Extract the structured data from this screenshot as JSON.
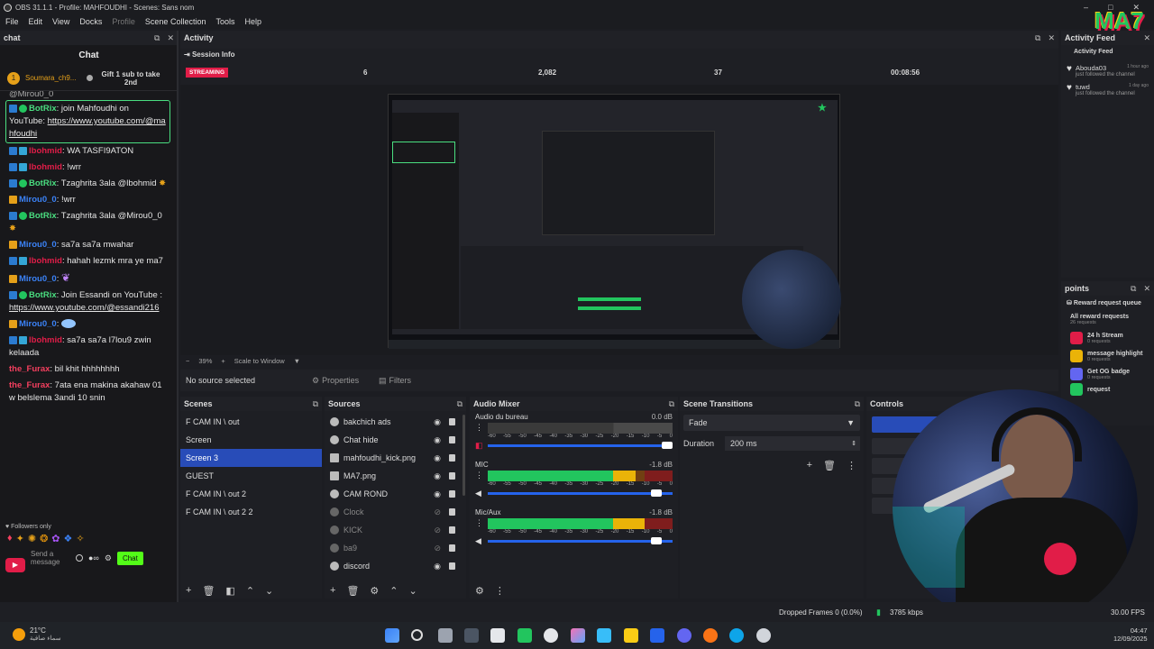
{
  "window": {
    "title": "OBS 31.1.1 - Profile: MAHFOUDHI - Scenes: Sans nom",
    "min": "–",
    "max": "□",
    "close": "✕"
  },
  "menu": [
    "File",
    "Edit",
    "View",
    "Docks",
    "Profile",
    "Scene Collection",
    "Tools",
    "Help"
  ],
  "chat": {
    "dock_title": "chat",
    "header": "Chat",
    "pinned_user": "Soumara_ch9...",
    "pinned_count": "1",
    "gift_text": "Gift 1 sub to take 2nd",
    "top_cut": "@Mirou0_0",
    "messages": [
      {
        "user": "BotRix",
        "text": ": join Mahfoudhi on YouTube: ",
        "link": "https://www.youtube.com/@mahfoudhi"
      },
      {
        "user": "lbohmid",
        "text": ": WA TASFI9ATON"
      },
      {
        "user": "lbohmid",
        "text": ": !wrr"
      },
      {
        "user": "BotRix",
        "text": ": Tzaghrita 3ala @lbohmid"
      },
      {
        "user": "Mirou0_0",
        "text": ": !wrr"
      },
      {
        "user": "BotRix",
        "text": ": Tzaghrita 3ala @Mirou0_0"
      },
      {
        "user": "Mirou0_0",
        "text": ": sa7a sa7a mwahar"
      },
      {
        "user": "lbohmid",
        "text": ": hahah lezmk mra ye ma7"
      },
      {
        "user": "Mirou0_0",
        "text": ": "
      },
      {
        "user": "BotRix",
        "text": ": Join Essandi on YouTube : ",
        "link": "https://www.youtube.com/@essandi216"
      },
      {
        "user": "Mirou0_0",
        "text": ": "
      },
      {
        "user": "lbohmid",
        "text": ": sa7a sa7a l7lou9 zwin kelaada"
      },
      {
        "user": "the_Furax",
        "text": ": bil khit hhhhhhhh"
      },
      {
        "user": "the_Furax",
        "text": ": 7ata ena makina akahaw 01 w belslema 3andi 10 snin"
      }
    ],
    "followers_only": "Followers only",
    "send_placeholder": "Send a message",
    "chat_button": "Chat"
  },
  "activity": {
    "dock_title": "Activity",
    "session_info": "Session Info",
    "status": "STREAMING",
    "stat1": "6",
    "stat2": "2,082",
    "stat3": "37",
    "time": "00:08:56"
  },
  "preview": {
    "zoom": "39%",
    "scale": "Scale to Window",
    "no_source": "No source selected",
    "properties": "Properties",
    "filters": "Filters"
  },
  "scenes": {
    "title": "Scenes",
    "items": [
      "F CAM IN \\ out",
      "Screen",
      "Screen 3",
      "GUEST",
      "F CAM IN \\ out 2",
      "F CAM IN \\ out 2 2"
    ],
    "selected": 2
  },
  "sources": {
    "title": "Sources",
    "items": [
      {
        "name": "bakchich ads",
        "dim": false
      },
      {
        "name": "Chat hide",
        "dim": false
      },
      {
        "name": "mahfoudhi_kick.png",
        "dim": false
      },
      {
        "name": "MA7.png",
        "dim": false
      },
      {
        "name": "CAM ROND",
        "dim": false
      },
      {
        "name": "Clock",
        "dim": true
      },
      {
        "name": "KICK",
        "dim": true
      },
      {
        "name": "ba9",
        "dim": true
      },
      {
        "name": "discord",
        "dim": false
      }
    ]
  },
  "mixer": {
    "title": "Audio Mixer",
    "channels": [
      {
        "name": "Audio du bureau",
        "db": "0.0 dB",
        "level": 0
      },
      {
        "name": "MIC",
        "db": "-1.8 dB",
        "level": 0.8
      },
      {
        "name": "Mic/Aux",
        "db": "-1.8 dB",
        "level": 0.85
      }
    ],
    "ticks": [
      "-60",
      "-55",
      "-50",
      "-45",
      "-40",
      "-35",
      "-30",
      "-25",
      "-20",
      "-15",
      "-10",
      "-5",
      "0"
    ]
  },
  "transitions": {
    "title": "Scene Transitions",
    "type": "Fade",
    "duration_label": "Duration",
    "duration": "200 ms"
  },
  "controls": {
    "title": "Controls"
  },
  "activity_feed": {
    "dock_title": "Activity Feed",
    "header": "Activity Feed",
    "items": [
      {
        "user": "Abouda03",
        "text": "just followed the channel",
        "time": "1 hour ago"
      },
      {
        "user": "tuwd",
        "text": "just followed the channel",
        "time": "1 day ago"
      }
    ]
  },
  "points": {
    "dock_title": "points",
    "queue": "Reward request queue",
    "all": "All reward requests",
    "all_count": "26 requests",
    "items": [
      {
        "name": "24 h Stream",
        "count": "0 requests",
        "color": "#e11d48"
      },
      {
        "name": "message highlight",
        "count": "0 requests",
        "color": "#eab308"
      },
      {
        "name": "Get OG badge",
        "count": "0 requests",
        "color": "#6366f1"
      },
      {
        "name": "request",
        "count": "",
        "color": "#22c55e"
      }
    ]
  },
  "statusbar": {
    "dropped": "Dropped Frames 0 (0.0%)",
    "bitrate": "3785 kbps",
    "fps": "30.00 FPS"
  },
  "taskbar": {
    "temp": "21°C",
    "weather": "سماء صافية",
    "time": "04:47",
    "date": "12/09/2025"
  },
  "overlay": {
    "logo": "MA7"
  },
  "colors": {
    "accent": "#284cb8",
    "green": "#22c55e",
    "streaming": "#e11d48"
  }
}
